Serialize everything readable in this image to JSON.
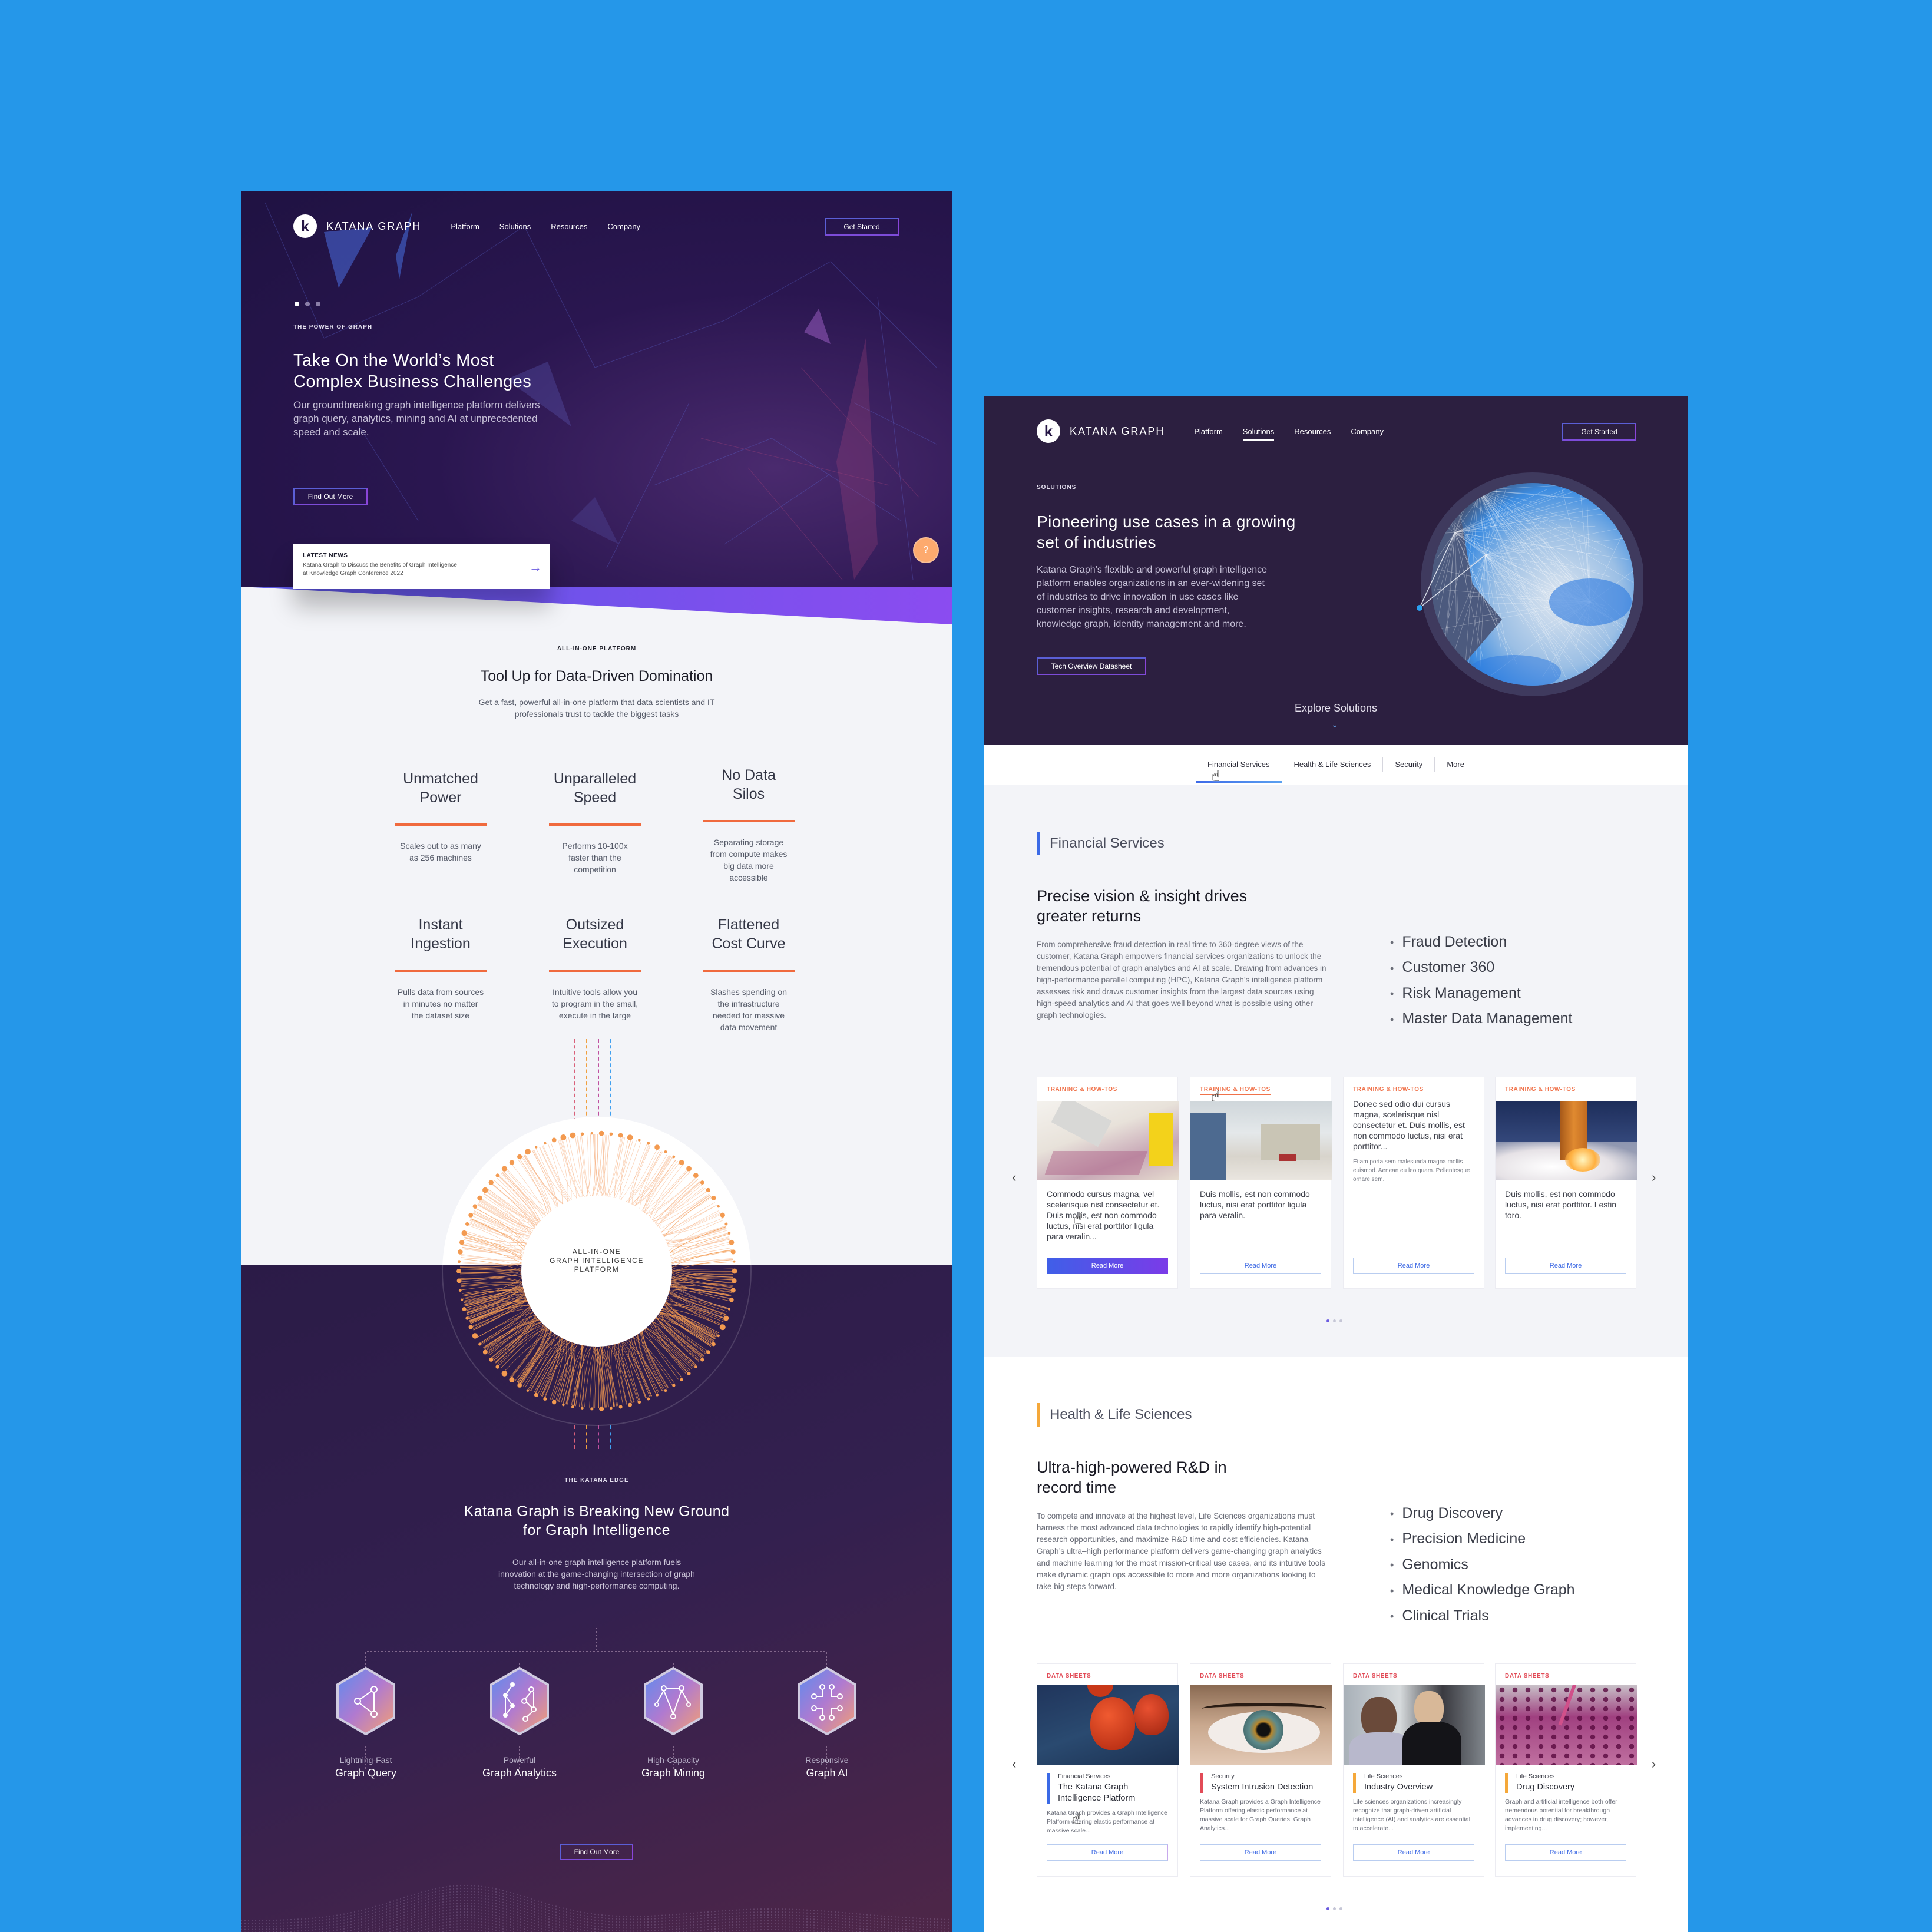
{
  "colors": {
    "background": "#2597e9",
    "hero_dark": "#2a1650",
    "accent_orange": "#f06a3e",
    "accent_blue": "#3b6ae6",
    "accent_yellow": "#f5a83a",
    "tag_training": "#f0724a",
    "tag_datasheet": "#e24b57"
  },
  "home_page": {
    "nav": {
      "logo_text": "KATANA GRAPH",
      "links": [
        "Platform",
        "Solutions",
        "Resources",
        "Company"
      ],
      "cta": "Get Started"
    },
    "hero": {
      "slide_count": 3,
      "active_slide": 1,
      "eyebrow": "THE POWER OF GRAPH",
      "title_line1": "Take On the World’s Most",
      "title_line2": "Complex Business Challenges",
      "subtitle_line1": "Our groundbreaking graph intelligence platform delivers",
      "subtitle_line2": "graph query, analytics, mining and AI at unprecedented",
      "subtitle_line3": "speed and scale.",
      "cta": "Find Out More",
      "help_button": "?"
    },
    "latest_news": {
      "label": "LATEST NEWS",
      "text_line1": "Katana Graph to Discuss the Benefits of Graph Intelligence",
      "text_line2": "at Knowledge Graph Conference 2022",
      "arrow": "→"
    },
    "platform": {
      "eyebrow": "ALL-IN-ONE PLATFORM",
      "title": "Tool Up for Data-Driven Domination",
      "subtitle_line1": "Get a fast, powerful all-in-one platform that data scientists and IT",
      "subtitle_line2": "professionals trust to tackle the biggest tasks",
      "features": [
        {
          "title_1": "Unmatched",
          "title_2": "Power",
          "desc": "Scales out to as many as 256 machines"
        },
        {
          "title_1": "Unparalleled",
          "title_2": "Speed",
          "desc": "Performs 10-100x faster than the competition"
        },
        {
          "title_1": "No Data",
          "title_2": "Silos",
          "desc": "Separating storage from compute makes big data more accessible"
        },
        {
          "title_1": "Instant",
          "title_2": "Ingestion",
          "desc": "Pulls data from sources in minutes no matter the dataset size"
        },
        {
          "title_1": "Outsized",
          "title_2": "Execution",
          "desc": "Intuitive tools allow you to program in the small, execute in the large"
        },
        {
          "title_1": "Flattened",
          "title_2": "Cost Curve",
          "desc": "Slashes spending on the infrastructure needed for massive data movement"
        }
      ],
      "orb_label_1": "ALL-IN-ONE",
      "orb_label_2": "GRAPH INTELLIGENCE",
      "orb_label_3": "PLATFORM"
    },
    "edge": {
      "eyebrow": "THE KATANA EDGE",
      "title_line1": "Katana Graph is Breaking New Ground",
      "title_line2": "for Graph Intelligence",
      "subtitle_line1": "Our all-in-one graph intelligence platform fuels",
      "subtitle_line2": "innovation at the game-changing intersection of graph",
      "subtitle_line3": "technology and high-performance computing.",
      "capabilities": [
        {
          "adjective": "Lightning-Fast",
          "name": "Graph Query",
          "icon": "graph-query-icon"
        },
        {
          "adjective": "Powerful",
          "name": "Graph Analytics",
          "icon": "graph-analytics-icon"
        },
        {
          "adjective": "High-Capacity",
          "name": "Graph Mining",
          "icon": "graph-mining-icon"
        },
        {
          "adjective": "Responsive",
          "name": "Graph AI",
          "icon": "graph-ai-icon"
        }
      ],
      "cta": "Find Out More"
    }
  },
  "solutions_page": {
    "nav": {
      "logo_text": "KATANA GRAPH",
      "links": [
        "Platform",
        "Solutions",
        "Resources",
        "Company"
      ],
      "active_link": "Solutions",
      "cta": "Get Started"
    },
    "hero": {
      "eyebrow": "SOLUTIONS",
      "title_line1": "Pioneering use cases in a growing",
      "title_line2": "set of industries",
      "body_line1": "Katana Graph’s flexible and powerful graph intelligence",
      "body_line2": "platform enables organizations in an ever-widening set",
      "body_line3": "of industries to drive innovation in use cases like",
      "body_line4": "customer insights, research and development,",
      "body_line5": "knowledge graph, identity management and more.",
      "cta": "Tech Overview Datasheet",
      "explore": "Explore Solutions"
    },
    "tabs": [
      "Financial Services",
      "Health & Life Sciences",
      "Security",
      "More"
    ],
    "active_tab": "Financial Services",
    "financial": {
      "label": "Financial Services",
      "title_line1": "Precise vision & insight drives",
      "title_line2": "greater returns",
      "body": "From comprehensive fraud detection in real time to 360-degree views of the customer, Katana Graph empowers financial services organizations to unlock the tremendous potential of graph analytics and AI at scale. Drawing from advances in high-performance parallel computing (HPC), Katana Graph’s intelligence platform assesses risk and draws customer insights from the largest data sources using high-speed analytics and AI that goes well beyond what is possible using other graph technologies.",
      "bullets": [
        "Fraud Detection",
        "Customer 360",
        "Risk Management",
        "Master Data Management"
      ],
      "cards": [
        {
          "tag": "TRAINING & HOW-TOS",
          "image": "pipette-lab-photo",
          "text": "Commodo cursus magna, vel scelerisque nisl consectetur et. Duis mollis, est non commodo luctus, nisi erat porttitor ligula para veralin...",
          "button": "Read More"
        },
        {
          "tag": "TRAINING & HOW-TOS",
          "image": "laboratory-room-photo",
          "text": "Duis mollis, est non commodo luctus, nisi erat porttitor ligula para veralin.",
          "button": "Read More"
        },
        {
          "tag": "TRAINING & HOW-TOS",
          "image": "",
          "text": "Donec sed odio dui cursus magna, scelerisque nisl consectetur et. Duis mollis, est non commodo luctus, nisi erat porttitor...",
          "small": "Etiam porta sem malesuada magna mollis euismod. Aenean eu leo quam. Pellentesque ornare sem.",
          "button": "Read More"
        },
        {
          "tag": "TRAINING & HOW-TOS",
          "image": "rocket-launch-photo",
          "text": "Duis mollis, est non commodo luctus, nisi erat porttitor. Lestin toro.",
          "button": "Read More"
        }
      ],
      "pager_count": 3,
      "pager_active": 1
    },
    "health": {
      "label": "Health & Life Sciences",
      "title_line1": "Ultra-high-powered R&D in",
      "title_line2": "record time",
      "body": "To compete and innovate at the highest level, Life Sciences organizations must harness the most advanced data technologies to rapidly identify high-potential research opportunities, and maximize R&D time and cost efficiencies. Katana Graph’s ultra–high performance platform delivers game-changing graph analytics and machine learning for the most mission-critical use cases, and its intuitive tools make dynamic graph ops accessible to more and more organizations looking to take big steps forward.",
      "bullets": [
        "Drug Discovery",
        "Precision Medicine",
        "Genomics",
        "Medical Knowledge Graph",
        "Clinical Trials"
      ],
      "cards": [
        {
          "tag": "DATA SHEETS",
          "image": "hot-air-balloons-photo",
          "category": "Financial Services",
          "title": "The Katana Graph Intelligence Platform",
          "desc": "Katana Graph provides a Graph Intelligence Platform offering elastic performance at massive scale...",
          "button": "Read More",
          "accent": "#3b6ae6"
        },
        {
          "tag": "DATA SHEETS",
          "image": "eye-closeup-photo",
          "category": "Security",
          "title": "System Intrusion Detection",
          "desc": "Katana Graph provides a Graph Intelligence Platform offering elastic performance at massive scale for Graph Queries, Graph Analytics...",
          "button": "Read More",
          "accent": "#e24b57"
        },
        {
          "tag": "DATA SHEETS",
          "image": "call-center-photo",
          "category": "Life Sciences",
          "title": "Industry Overview",
          "desc": "Life sciences organizations increasingly recognize that graph-driven artificial intelligence (AI) and analytics are essential to accelerate...",
          "button": "Read More",
          "accent": "#f5a83a"
        },
        {
          "tag": "DATA SHEETS",
          "image": "well-plate-photo",
          "category": "Life Sciences",
          "title": "Drug Discovery",
          "desc": "Graph and artificial intelligence both offer tremendous potential for breakthrough advances in drug discovery; however, implementing...",
          "button": "Read More",
          "accent": "#f5a83a"
        }
      ],
      "pager_count": 3,
      "pager_active": 1
    }
  }
}
